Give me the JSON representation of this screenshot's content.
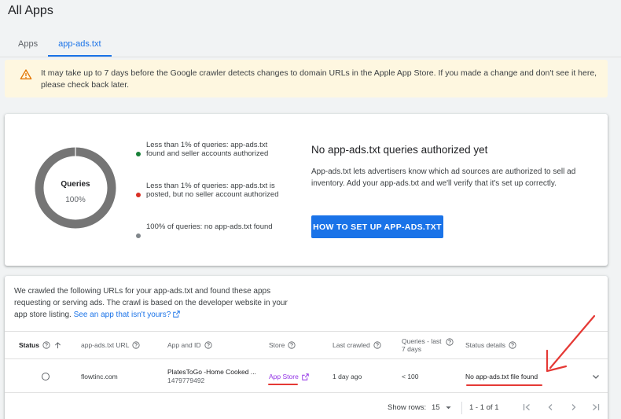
{
  "page": {
    "title": "All Apps"
  },
  "tabs": [
    {
      "label": "Apps",
      "active": false
    },
    {
      "label": "app-ads.txt",
      "active": true
    }
  ],
  "banner": {
    "icon": "warning-icon",
    "text": "It may take up to 7 days before the Google crawler detects changes to domain URLs in the Apple App Store. If you made a change and don't see it here, please check back later."
  },
  "summary": {
    "donut": {
      "title": "Queries",
      "subtitle": "100%",
      "percent_no_file": 100
    },
    "legend": [
      {
        "text": "Less than 1% of queries: app-ads.txt found and seller accounts authorized",
        "color": "#188038"
      },
      {
        "text": "Less than 1% of queries: app-ads.txt is posted, but no seller account authorized",
        "color": "#d93025"
      },
      {
        "text": "100% of queries: no app-ads.txt found",
        "color": "#80868b"
      }
    ],
    "cta": {
      "title": "No app-ads.txt queries authorized yet",
      "description": "App-ads.txt lets advertisers know which ad sources are authorized to sell ad inventory. Add your app-ads.txt and we'll verify that it's set up correctly.",
      "button_label": "HOW TO SET UP APP-ADS.TXT"
    }
  },
  "crawl": {
    "text": "We crawled the following URLs for your app-ads.txt and found these apps requesting or serving ads. The crawl is based on the developer website in your app store listing.",
    "link_label": "See an app that isn't yours?"
  },
  "table": {
    "columns": [
      "Status",
      "app-ads.txt URL",
      "App and ID",
      "Store",
      "Last crawled",
      "Queries - last 7 days",
      "Status details"
    ],
    "rows": [
      {
        "url": "flowtinc.com",
        "app_name": "PlatesToGo -Home Cooked ...",
        "app_id": "1479779492",
        "store": "App Store",
        "last_crawled": "1 day ago",
        "queries": "< 100",
        "status_details": "No app-ads.txt file found"
      }
    ]
  },
  "footer": {
    "show_rows_label": "Show rows:",
    "show_rows_value": "15",
    "range": "1 - 1 of 1"
  },
  "annotation_color": "#e53935"
}
